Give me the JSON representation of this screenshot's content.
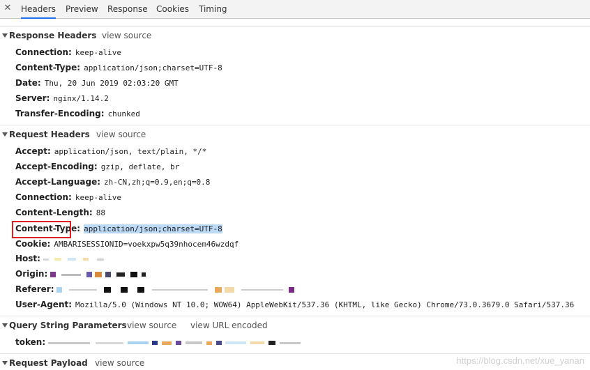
{
  "tabs": {
    "close_glyph": "✕",
    "items": [
      "Headers",
      "Preview",
      "Response",
      "Cookies",
      "Timing"
    ],
    "active": "Headers"
  },
  "response_headers": {
    "title": "Response Headers",
    "view_source": "view source",
    "rows": [
      {
        "name": "Connection:",
        "value": "keep-alive"
      },
      {
        "name": "Content-Type:",
        "value": "application/json;charset=UTF-8"
      },
      {
        "name": "Date:",
        "value": "Thu, 20 Jun 2019 02:03:20 GMT"
      },
      {
        "name": "Server:",
        "value": "nginx/1.14.2"
      },
      {
        "name": "Transfer-Encoding:",
        "value": "chunked"
      }
    ]
  },
  "request_headers": {
    "title": "Request Headers",
    "view_source": "view source",
    "rows": [
      {
        "name": "Accept:",
        "value": "application/json, text/plain, */*"
      },
      {
        "name": "Accept-Encoding:",
        "value": "gzip, deflate, br"
      },
      {
        "name": "Accept-Language:",
        "value": "zh-CN,zh;q=0.9,en;q=0.8"
      },
      {
        "name": "Connection:",
        "value": "keep-alive"
      },
      {
        "name": "Content-Length:",
        "value": "88"
      },
      {
        "name": "Content-Type:",
        "value": "application/json;charset=UTF-8"
      },
      {
        "name": "Cookie:",
        "value": "AMBARISESSIONID=voekxpw5q39nhocem46wzdqf"
      },
      {
        "name": "Host:",
        "value": ""
      },
      {
        "name": "Origin:",
        "value": ""
      },
      {
        "name": "Referer:",
        "value": ""
      },
      {
        "name": "User-Agent:",
        "value": "Mozilla/5.0 (Windows NT 10.0; WOW64) AppleWebKit/537.36 (KHTML, like Gecko) Chrome/73.0.3679.0 Safari/537.36"
      }
    ]
  },
  "query_string": {
    "title": "Query String Parameters",
    "view_source": "view source",
    "view_url_encoded": "view URL encoded",
    "rows": [
      {
        "name": "token:",
        "value": ""
      }
    ]
  },
  "request_payload": {
    "title": "Request Payload",
    "view_source": "view source"
  },
  "watermark": "https://blog.csdn.net/xue_yanan",
  "colors": {
    "highlight": "#bcd9f5",
    "annotation_box": "#e02020",
    "tab_underline": "#1a73e8"
  }
}
